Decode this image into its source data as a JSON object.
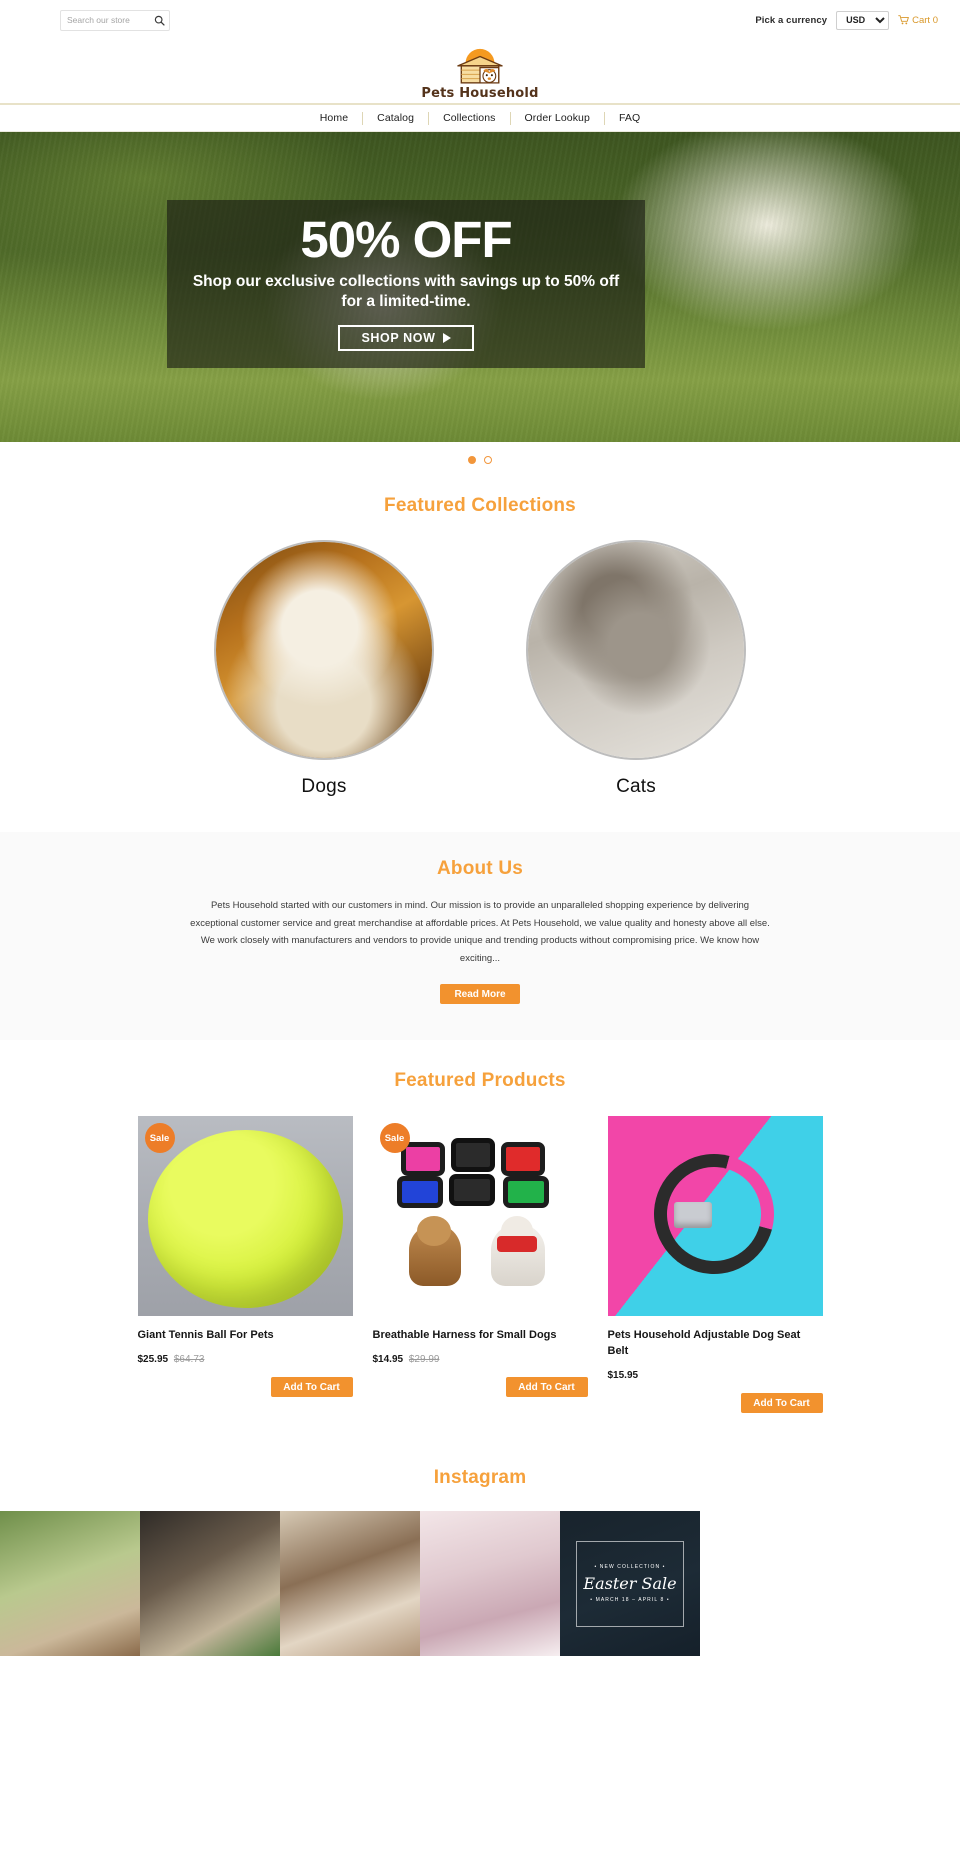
{
  "topbar": {
    "search_placeholder": "Search our store",
    "search_value": "",
    "search_icon": "search-icon",
    "currency_label": "Pick a currency",
    "currency_selected": "USD",
    "currency_options": [
      "USD"
    ],
    "cart_icon": "shopping-cart-icon",
    "cart_label": "Cart 0"
  },
  "logo": {
    "text": "Pets Household",
    "mark": "doghouse-sun-logo-icon"
  },
  "nav": {
    "items": [
      {
        "label": "Home"
      },
      {
        "label": "Catalog"
      },
      {
        "label": "Collections"
      },
      {
        "label": "Order Lookup"
      },
      {
        "label": "FAQ"
      }
    ]
  },
  "hero": {
    "headline": "50% OFF",
    "subhead": "Shop our exclusive collections with savings up to 50% off for a limited-time.",
    "cta": "SHOP NOW",
    "cta_icon": "play-triangle-icon",
    "slides": 2,
    "active_slide": 1
  },
  "collections": {
    "title": "Featured Collections",
    "items": [
      {
        "name": "Dogs",
        "image": "dog-photo"
      },
      {
        "name": "Cats",
        "image": "cat-photo"
      }
    ]
  },
  "about": {
    "title": "About Us",
    "body": "Pets Household started with our customers in mind. Our mission is to provide an unparalleled shopping experience by delivering exceptional customer service and great merchandise at affordable prices.   At Pets Household, we value quality and honesty above all else. We work closely with manufacturers and vendors to provide unique and trending products without compromising price. We know how exciting...",
    "read_more": "Read More"
  },
  "products": {
    "title": "Featured Products",
    "add_to_cart": "Add To Cart",
    "sale_badge": "Sale",
    "items": [
      {
        "title": "Giant Tennis Ball For Pets",
        "price": "$25.95",
        "compare_price": "$64.73",
        "on_sale": true,
        "image": "giant-tennis-ball"
      },
      {
        "title": "Breathable Harness for Small Dogs",
        "price": "$14.95",
        "compare_price": "$29.99",
        "on_sale": true,
        "image": "dog-harness-colors"
      },
      {
        "title": "Pets Household Adjustable Dog Seat Belt",
        "price": "$15.95",
        "compare_price": "",
        "on_sale": false,
        "image": "dog-seat-belt"
      }
    ]
  },
  "instagram": {
    "title": "Instagram",
    "tiles": [
      {
        "alt": "puppy-with-toy"
      },
      {
        "alt": "pug-with-green-toy"
      },
      {
        "alt": "dog-on-couch-with-person"
      },
      {
        "alt": "white-fluffy-cat"
      },
      {
        "alt": "easter-sale-promo"
      }
    ],
    "promo": {
      "top": "• NEW COLLECTION •",
      "middle": "Easter Sale",
      "bottom": "• MARCH 18 – APRIL 8 •"
    }
  },
  "colors": {
    "accent_orange": "#f2922e",
    "heading_orange": "#f6a13c",
    "sale_badge": "#ed7d28",
    "logo_brown": "#54331b",
    "cart_gold": "#d9982a"
  }
}
